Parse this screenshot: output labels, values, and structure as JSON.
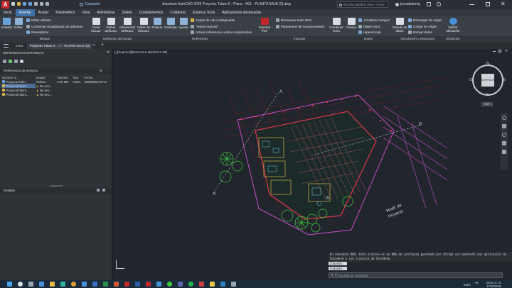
{
  "window": {
    "title": "Autodesk AutoCAD 2025    Proyecto Tulum 5 - Plano - A01 - PLANTA BAJA (2).dwg",
    "share_label": "Compartir",
    "search_placeholder": "Escriba palabra clave o frase",
    "user": "jncsalabertig",
    "app_letter": "A"
  },
  "menu": [
    "Inicio",
    "Insertar",
    "Anotar",
    "Parametrico",
    "Vista",
    "Administrar",
    "Salida",
    "Complementos",
    "Colaborar",
    "Express Tools",
    "Aplicaciones destacadas"
  ],
  "ribbon": {
    "insert_label": "Insertar",
    "edit_label": "Editar",
    "block_items": [
      "Editar atributo",
      "Conservar visualización de atributos",
      "Reemplazar"
    ],
    "block_panel": "Bloque",
    "create_block": "Crear bloque",
    "define_attributes": "Definir atributos",
    "manage_attributes": "Administrar atributos",
    "block_editor": "Editor de bloques",
    "blockdef_panel": "Definición de bloque",
    "attach": "Enlazar",
    "clip": "Delimitar",
    "adjust": "Ajustar",
    "ref_items": [
      "Capas de calco subyacente",
      "*Varias marcas*",
      "Activar referencia a calcos subyacentes"
    ],
    "ref_panel": "Referencia",
    "import_pdf": "Importar PDF",
    "import_items": [
      "Reconocer texto SHX",
      "Parámetros de reconocimiento"
    ],
    "import_panel": "Importar",
    "combine_text": "Combinar texto",
    "field": "Campo",
    "data_items": [
      "Actualizar campos",
      "Objeto OLE",
      "Hipervínculo"
    ],
    "data_panel": "Datos",
    "link_data": "Vínculo de datos",
    "link_items": [
      "Descargar de origen",
      "Cargar en origen",
      "Extraer datos"
    ],
    "link_panel": "Vinculación y extracción",
    "set_location": "Definir ubicación",
    "location_panel": "Ubicación"
  },
  "tabs": {
    "home": "Inicio",
    "active": "Proyecto Tulum 5- ...Y - PLANTA BAJA (3)",
    "close": "×",
    "add": "+"
  },
  "xref": {
    "title": "REFERENCIAS EXTERNAS",
    "section": "Referencias de archivos",
    "columns": [
      "Nombre d...",
      "Estado",
      "Tamaño",
      "Tipo",
      "Fecha"
    ],
    "rows": [
      {
        "name": "Proyecto Tulu...",
        "status": "Abierto",
        "size": "6.66 MB",
        "type": "Activo",
        "date": "22/06/2023 07:4.."
      },
      {
        "name": "ProyectoTulum...",
        "status": "No enc...",
        "size": "",
        "type": "",
        "date": ""
      },
      {
        "name": "ProyectoTulum...",
        "status": "No enc...",
        "size": "",
        "type": "",
        "date": ""
      },
      {
        "name": "ProyectoTulum...",
        "status": "No enc...",
        "size": "",
        "type": "",
        "date": ""
      }
    ],
    "details": "Detalles"
  },
  "viewport": {
    "label": "[-][Superior][Estructura alámbrica 2D]",
    "viewcube": "SUPERIOR",
    "compass": [
      "N",
      "E",
      "S",
      "O"
    ],
    "wcs": "SCP",
    "annotations": [
      "Modif. de",
      "Proyecto"
    ],
    "section_marks": [
      "A",
      "B",
      "A'",
      "B'"
    ]
  },
  "command": {
    "history": "En Autodesk DWG. Este archivo es un DWG de confianza guardado por última vez mediante una aplicación de Autodesk o con licencia de Autodesk.",
    "line1": "Comando:",
    "line2": "Comando:",
    "placeholder": "Escriba un comando"
  },
  "taskbar": {
    "time": "05:52 a. m.",
    "date": "17/06/2024",
    "lang": "ENG"
  },
  "colors": {
    "accent": "#3f6fa6",
    "drawing_red": "#e0384a",
    "drawing_magenta": "#c94cc8",
    "drawing_green": "#3cc83c"
  }
}
